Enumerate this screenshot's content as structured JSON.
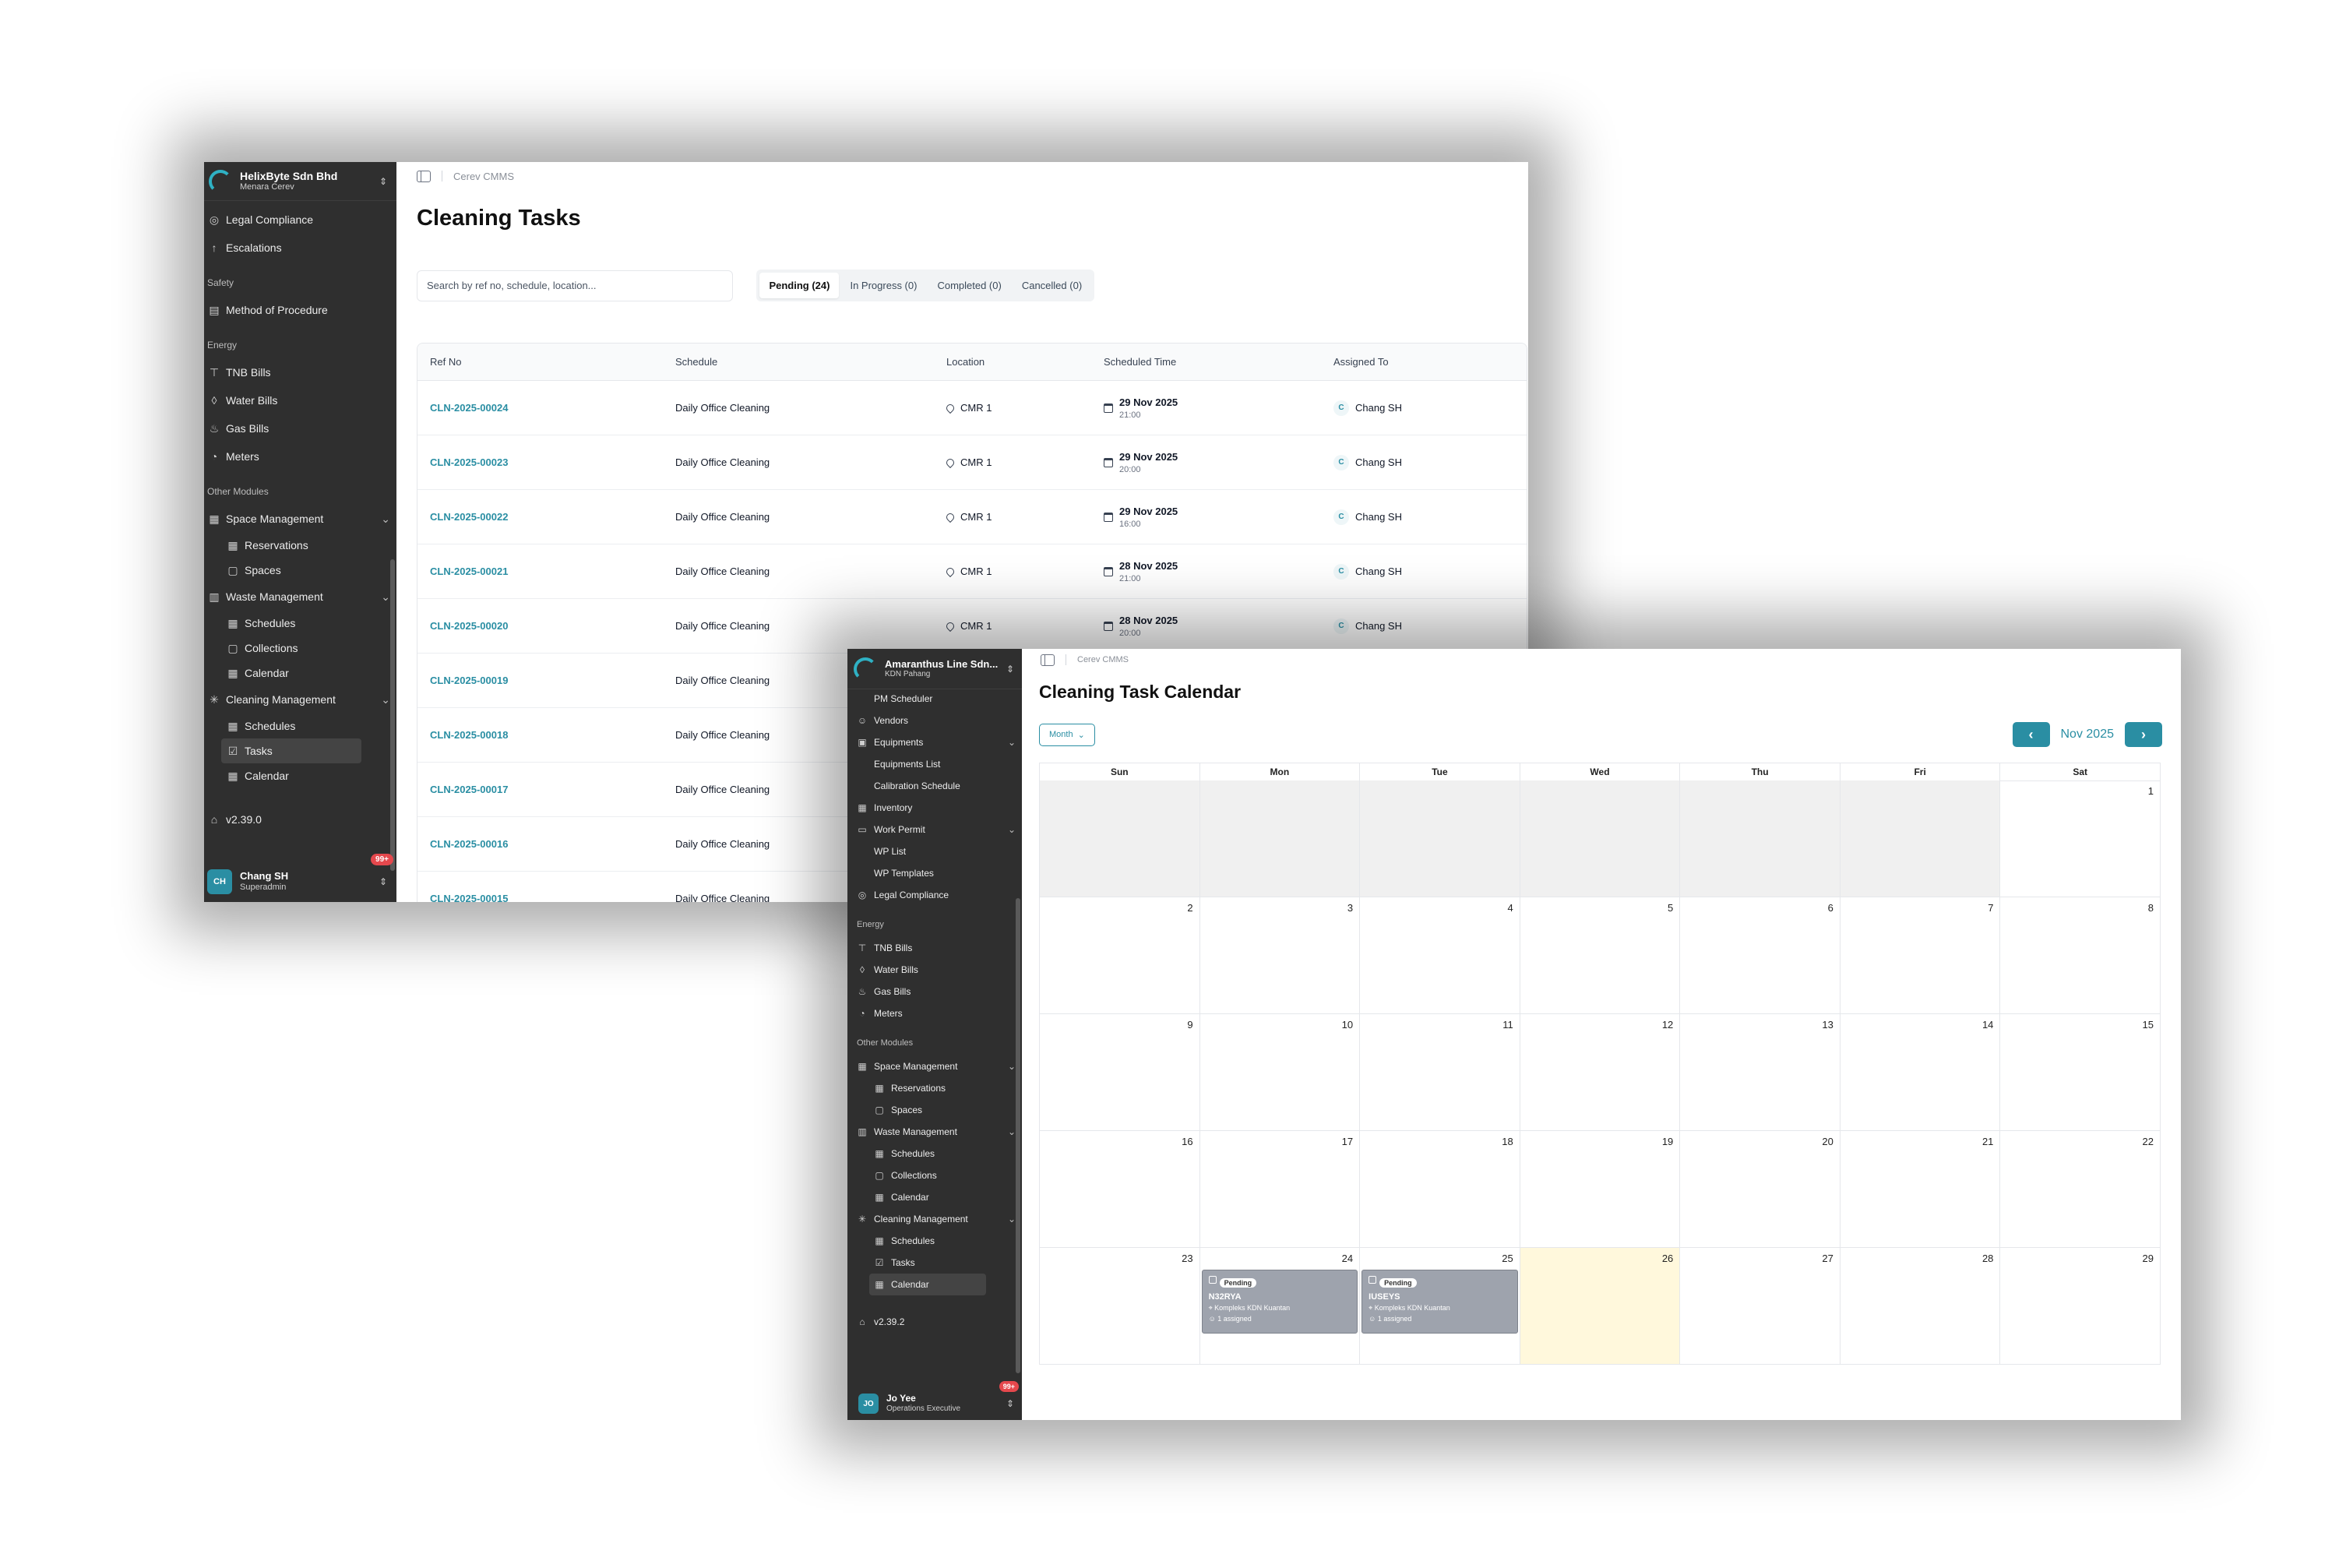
{
  "screen1": {
    "sidebar": {
      "org_name": "HelixByte Sdn Bhd",
      "org_sub": "Menara Cerev",
      "items_top": [
        {
          "label": "Legal Compliance",
          "icon": "shield-check-icon"
        },
        {
          "label": "Escalations",
          "icon": "arrow-up-icon"
        }
      ],
      "section_safety": "Safety",
      "safety_items": [
        {
          "label": "Method of Procedure",
          "icon": "document-icon"
        }
      ],
      "section_energy": "Energy",
      "energy_items": [
        {
          "label": "TNB Bills",
          "icon": "tower-icon"
        },
        {
          "label": "Water Bills",
          "icon": "droplet-icon"
        },
        {
          "label": "Gas Bills",
          "icon": "flame-icon"
        },
        {
          "label": "Meters",
          "icon": "gauge-icon"
        }
      ],
      "section_other": "Other Modules",
      "space_mgmt": "Space Management",
      "space_items": [
        "Reservations",
        "Spaces"
      ],
      "waste_mgmt": "Waste Management",
      "waste_items": [
        "Schedules",
        "Collections",
        "Calendar"
      ],
      "cleaning_mgmt": "Cleaning Management",
      "cleaning_items": [
        "Schedules",
        "Tasks",
        "Calendar"
      ],
      "version": "v2.39.0",
      "user_initials": "CH",
      "user_name": "Chang SH",
      "user_role": "Superadmin",
      "notif_badge": "99+"
    },
    "breadcrumb": "Cerev CMMS",
    "title": "Cleaning Tasks",
    "search_placeholder": "Search by ref no, schedule, location...",
    "tabs": [
      "Pending (24)",
      "In Progress (0)",
      "Completed (0)",
      "Cancelled (0)"
    ],
    "columns": [
      "Ref No",
      "Schedule",
      "Location",
      "Scheduled Time",
      "Assigned To"
    ],
    "rows": [
      {
        "ref": "CLN-2025-00024",
        "schedule": "Daily Office Cleaning",
        "location": "CMR 1",
        "date": "29 Nov 2025",
        "time": "21:00",
        "initial": "C",
        "assignee": "Chang SH"
      },
      {
        "ref": "CLN-2025-00023",
        "schedule": "Daily Office Cleaning",
        "location": "CMR 1",
        "date": "29 Nov 2025",
        "time": "20:00",
        "initial": "C",
        "assignee": "Chang SH"
      },
      {
        "ref": "CLN-2025-00022",
        "schedule": "Daily Office Cleaning",
        "location": "CMR 1",
        "date": "29 Nov 2025",
        "time": "16:00",
        "initial": "C",
        "assignee": "Chang SH"
      },
      {
        "ref": "CLN-2025-00021",
        "schedule": "Daily Office Cleaning",
        "location": "CMR 1",
        "date": "28 Nov 2025",
        "time": "21:00",
        "initial": "C",
        "assignee": "Chang SH"
      },
      {
        "ref": "CLN-2025-00020",
        "schedule": "Daily Office Cleaning",
        "location": "CMR 1",
        "date": "28 Nov 2025",
        "time": "20:00",
        "initial": "C",
        "assignee": "Chang SH"
      },
      {
        "ref": "CLN-2025-00019",
        "schedule": "Daily Office Cleaning"
      },
      {
        "ref": "CLN-2025-00018",
        "schedule": "Daily Office Cleaning"
      },
      {
        "ref": "CLN-2025-00017",
        "schedule": "Daily Office Cleaning"
      },
      {
        "ref": "CLN-2025-00016",
        "schedule": "Daily Office Cleaning"
      },
      {
        "ref": "CLN-2025-00015",
        "schedule": "Daily Office Cleaning"
      }
    ]
  },
  "screen2": {
    "sidebar": {
      "org_name": "Amaranthus Line Sdn...",
      "org_sub": "KDN Pahang",
      "items": [
        {
          "label": "PM Scheduler",
          "level": "sub2"
        },
        {
          "label": "Vendors",
          "icon": "users-icon"
        },
        {
          "label": "Equipments",
          "icon": "box-icon",
          "chevron": true
        },
        {
          "label": "Equipments List",
          "level": "sub2"
        },
        {
          "label": "Calibration Schedule",
          "level": "sub2"
        },
        {
          "label": "Inventory",
          "icon": "boxes-icon"
        },
        {
          "label": "Work Permit",
          "icon": "file-icon",
          "chevron": true
        },
        {
          "label": "WP List",
          "level": "sub2"
        },
        {
          "label": "WP Templates",
          "level": "sub2"
        },
        {
          "label": "Legal Compliance",
          "icon": "shield-check-icon"
        }
      ],
      "section_energy": "Energy",
      "energy_items": [
        {
          "label": "TNB Bills",
          "icon": "tower-icon"
        },
        {
          "label": "Water Bills",
          "icon": "droplet-icon"
        },
        {
          "label": "Gas Bills",
          "icon": "flame-icon"
        },
        {
          "label": "Meters",
          "icon": "gauge-icon"
        }
      ],
      "section_other": "Other Modules",
      "space_mgmt": "Space Management",
      "space_items": [
        "Reservations",
        "Spaces"
      ],
      "waste_mgmt": "Waste Management",
      "waste_items": [
        "Schedules",
        "Collections",
        "Calendar"
      ],
      "cleaning_mgmt": "Cleaning Management",
      "cleaning_items": [
        "Schedules",
        "Tasks",
        "Calendar"
      ],
      "version": "v2.39.2",
      "user_initials": "JO",
      "user_name": "Jo Yee",
      "user_role": "Operations Executive",
      "notif_badge": "99+"
    },
    "breadcrumb": "Cerev CMMS",
    "title": "Cleaning Task Calendar",
    "view_select": "Month",
    "month_label": "Nov 2025",
    "weekdays": [
      "Sun",
      "Mon",
      "Tue",
      "Wed",
      "Thu",
      "Fri",
      "Sat"
    ],
    "weeks": [
      [
        "",
        "",
        "",
        "",
        "",
        "",
        "1"
      ],
      [
        "2",
        "3",
        "4",
        "5",
        "6",
        "7",
        "8"
      ],
      [
        "9",
        "10",
        "11",
        "12",
        "13",
        "14",
        "15"
      ],
      [
        "16",
        "17",
        "18",
        "19",
        "20",
        "21",
        "22"
      ],
      [
        "23",
        "24",
        "25",
        "26",
        "27",
        "28",
        "29"
      ]
    ],
    "today": "26",
    "events": [
      {
        "day": "24",
        "status": "Pending",
        "code": "N32RYA",
        "location": "Kompleks KDN Kuantan",
        "assigned": "1 assigned"
      },
      {
        "day": "25",
        "status": "Pending",
        "code": "IUSEYS",
        "location": "Kompleks KDN Kuantan",
        "assigned": "1 assigned"
      }
    ]
  },
  "colors": {
    "accent": "#2a8ea3",
    "sidebar": "#2f2f2f",
    "today": "#fff8dc",
    "event": "#9ea3ad",
    "notif": "#e5484d"
  }
}
